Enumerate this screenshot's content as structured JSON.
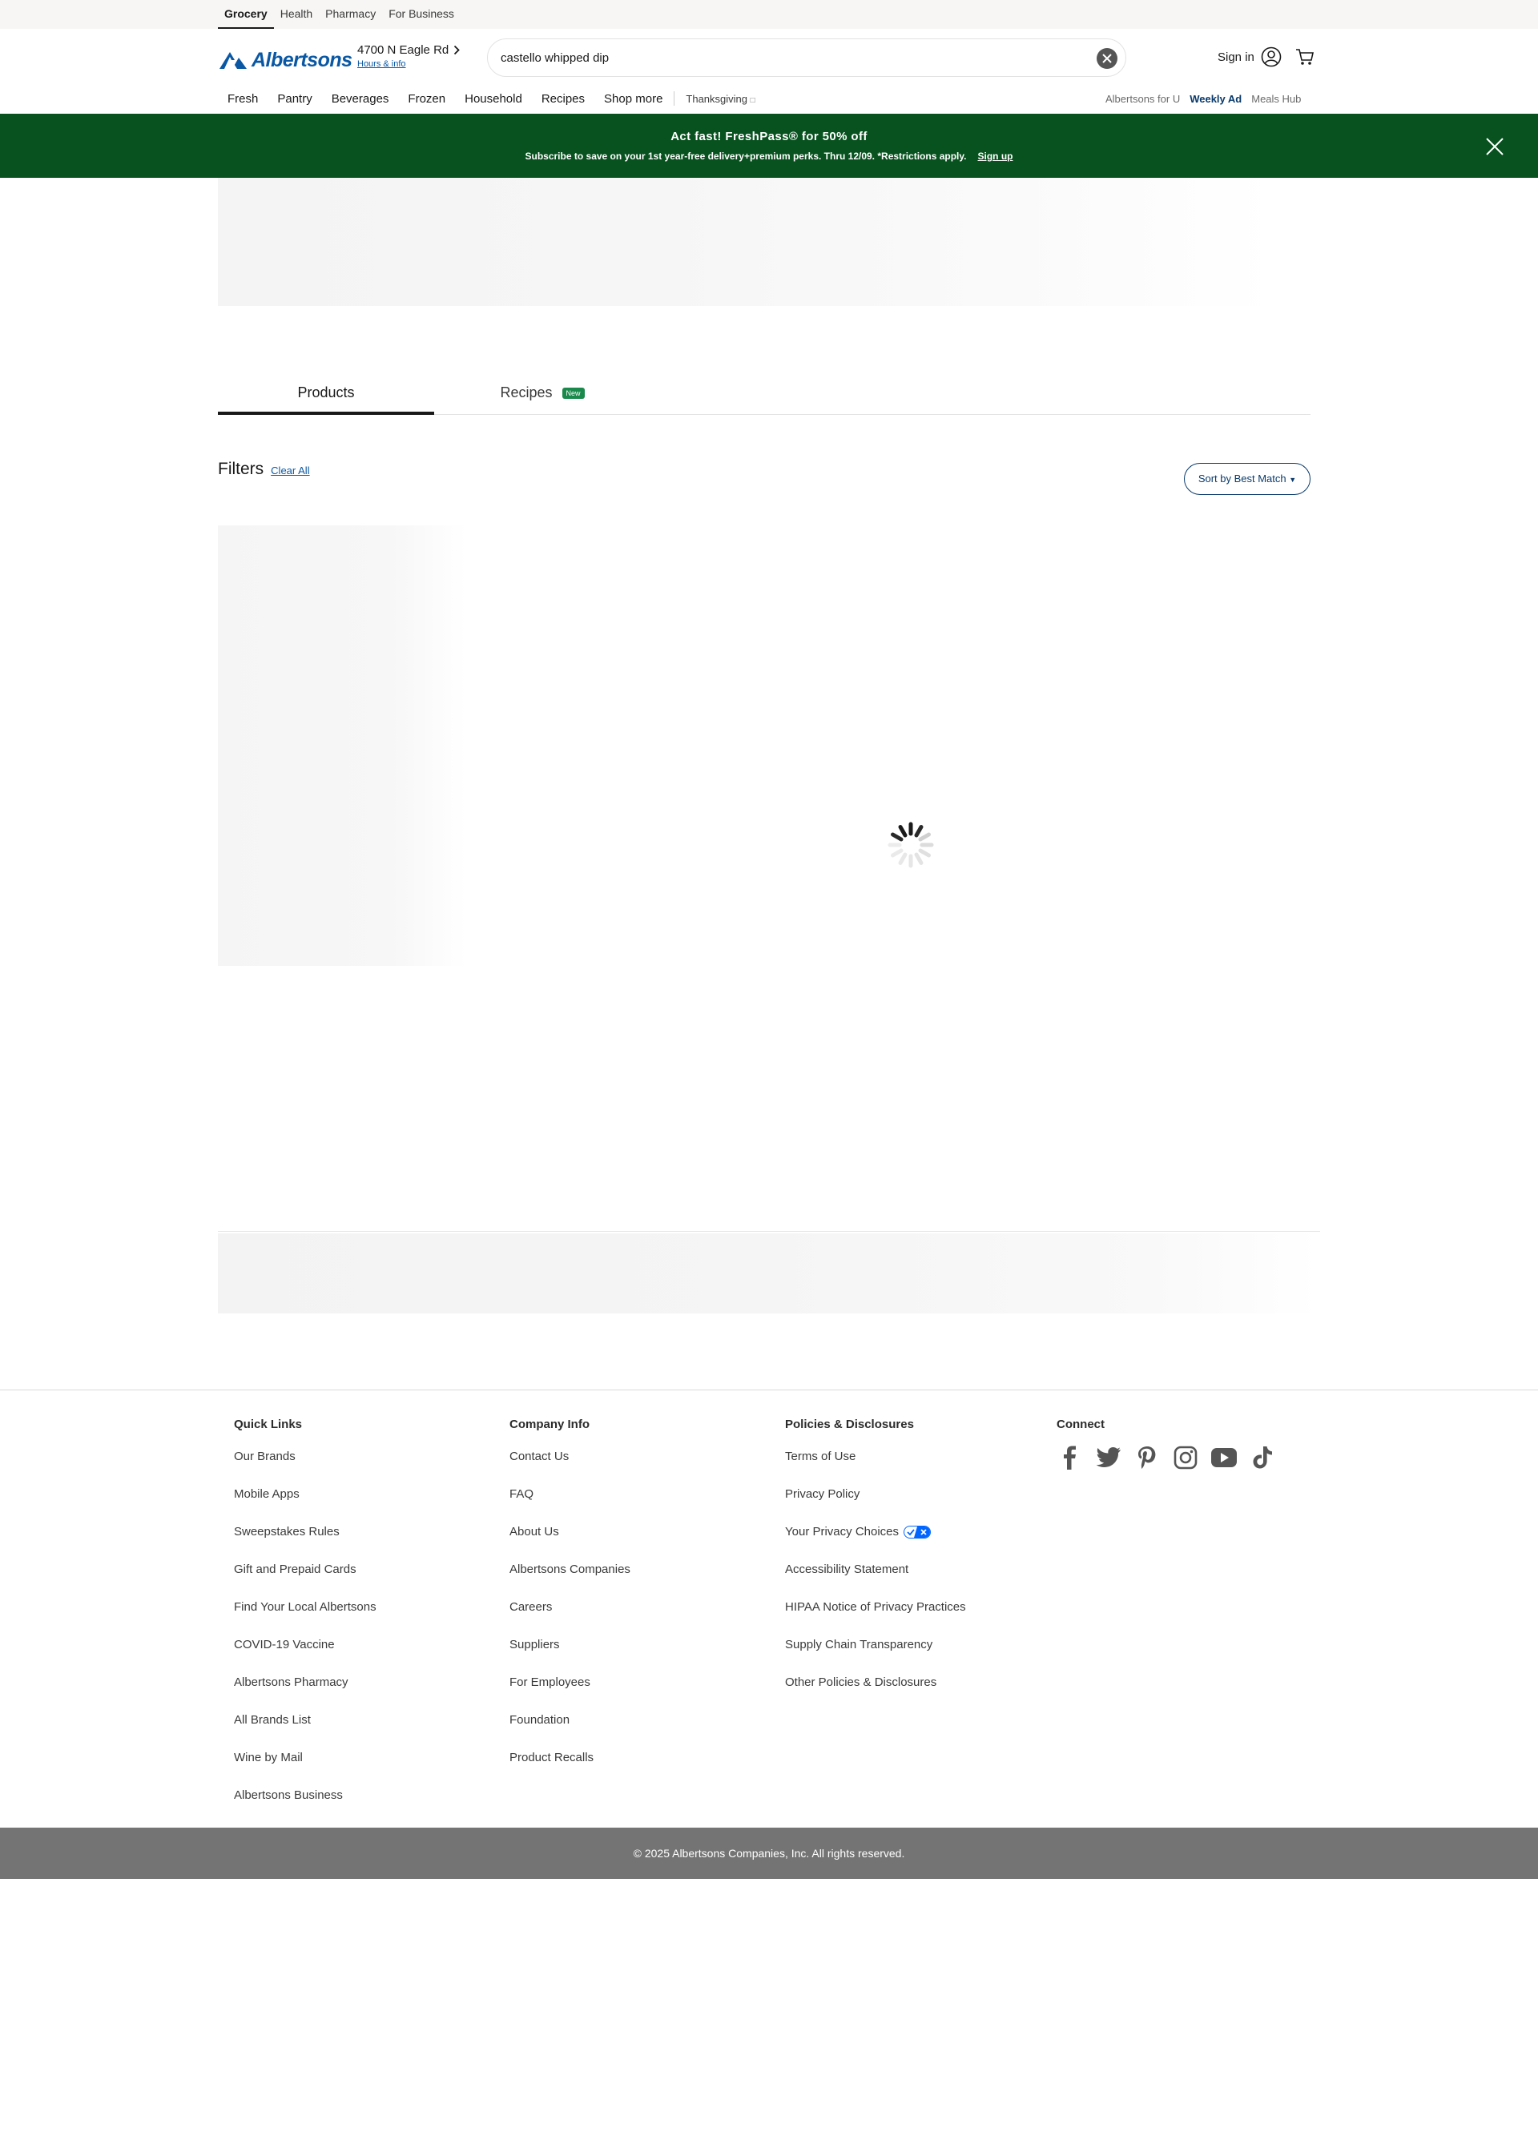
{
  "topbar": {
    "tabs": [
      "Grocery",
      "Health",
      "Pharmacy",
      "For Business"
    ]
  },
  "header": {
    "logo": "Albertsons",
    "store_name": "4700 N Eagle Rd",
    "store_hours": "Hours & info",
    "search_value": "castello whipped dip",
    "signin_label": "Sign in"
  },
  "nav": {
    "items": [
      "Fresh",
      "Pantry",
      "Beverages",
      "Frozen",
      "Household",
      "Recipes",
      "Shop more"
    ],
    "seasonal": "Thanksgiving",
    "right": [
      "Albertsons for U",
      "Weekly Ad",
      "Meals Hub"
    ]
  },
  "promo": {
    "title": "Act fast! FreshPass® for 50% off",
    "subtitle": "Subscribe to save on your 1st year-free delivery+premium perks. Thru 12/09. *Restrictions apply.",
    "signup": "Sign up"
  },
  "results": {
    "tabs": [
      "Products",
      "Recipes"
    ],
    "new_badge": "New",
    "filters_title": "Filters",
    "clear_all": "Clear All",
    "sort_label": "Sort by Best Match"
  },
  "footer": {
    "quick_links": {
      "title": "Quick Links",
      "items": [
        "Our Brands",
        "Mobile Apps",
        "Sweepstakes Rules",
        "Gift and Prepaid Cards",
        "Find Your Local Albertsons",
        "COVID-19 Vaccine",
        "Albertsons Pharmacy",
        "All Brands List",
        "Wine by Mail",
        "Albertsons Business"
      ]
    },
    "company_info": {
      "title": "Company Info",
      "items": [
        "Contact Us",
        "FAQ",
        "About Us",
        "Albertsons Companies",
        "Careers",
        "Suppliers",
        "For Employees",
        "Foundation",
        "Product Recalls"
      ]
    },
    "policies": {
      "title": "Policies & Disclosures",
      "items": [
        "Terms of Use",
        "Privacy Policy",
        "Your Privacy Choices",
        "Accessibility Statement",
        "HIPAA Notice of Privacy Practices",
        "Supply Chain Transparency",
        "Other Policies & Disclosures"
      ]
    },
    "connect": {
      "title": "Connect",
      "icons": [
        "facebook-icon",
        "twitter-icon",
        "pinterest-icon",
        "instagram-icon",
        "youtube-icon",
        "tiktok-icon"
      ]
    },
    "copyright": "© 2025 Albertsons Companies, Inc.  All rights reserved."
  },
  "colors": {
    "brand": "#0a58a4",
    "promo_bg": "#07521e",
    "copyright_bg": "#747474",
    "new_badge": "#1a8a4c"
  }
}
